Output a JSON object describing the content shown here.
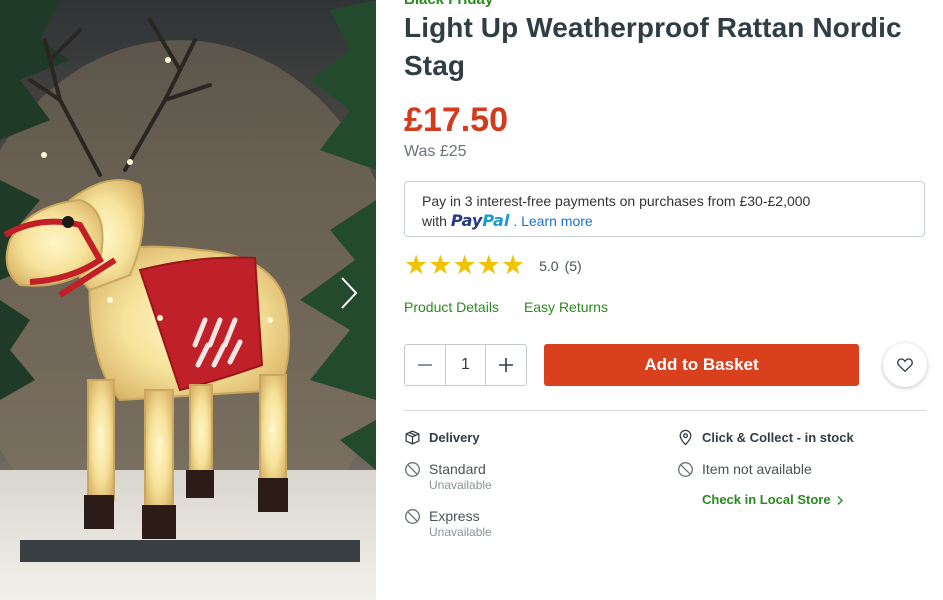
{
  "product": {
    "badge": "Black Friday",
    "title": "Light Up Weatherproof Rattan Nordic Stag",
    "price": "£17.50",
    "was_price": "Was £25",
    "image_alt": "Light up rattan reindeer decoration"
  },
  "paypal": {
    "line1": "Pay in 3 interest-free payments on purchases from £30-£2,000",
    "with_text": "with",
    "logo_pay": "Pay",
    "logo_pal": "Pal",
    "learn_more": ". Learn more"
  },
  "rating": {
    "stars_filled": 5,
    "stars_total": 5,
    "score": "5.0",
    "count": "(5)"
  },
  "links": {
    "details": "Product Details",
    "returns": "Easy Returns"
  },
  "purchase": {
    "quantity": "1",
    "add_label": "Add to Basket"
  },
  "delivery": {
    "heading": "Delivery",
    "standard_label": "Standard",
    "standard_status": "Unavailable",
    "express_label": "Express",
    "express_status": "Unavailable"
  },
  "collect": {
    "heading": "Click & Collect - in stock",
    "item_status": "Item not available",
    "check_store": "Check in Local Store"
  },
  "colors": {
    "price_red": "#d43a1c",
    "button_red": "#d8401e",
    "link_green": "#2a8a1f",
    "star_yellow": "#f2c200",
    "paypal_dark": "#253b80",
    "paypal_light": "#179bd7"
  },
  "icons": [
    "chevron-right-icon",
    "minus-icon",
    "plus-icon",
    "heart-icon",
    "package-icon",
    "location-pin-icon",
    "unavailable-icon",
    "chevron-right-small-icon"
  ]
}
